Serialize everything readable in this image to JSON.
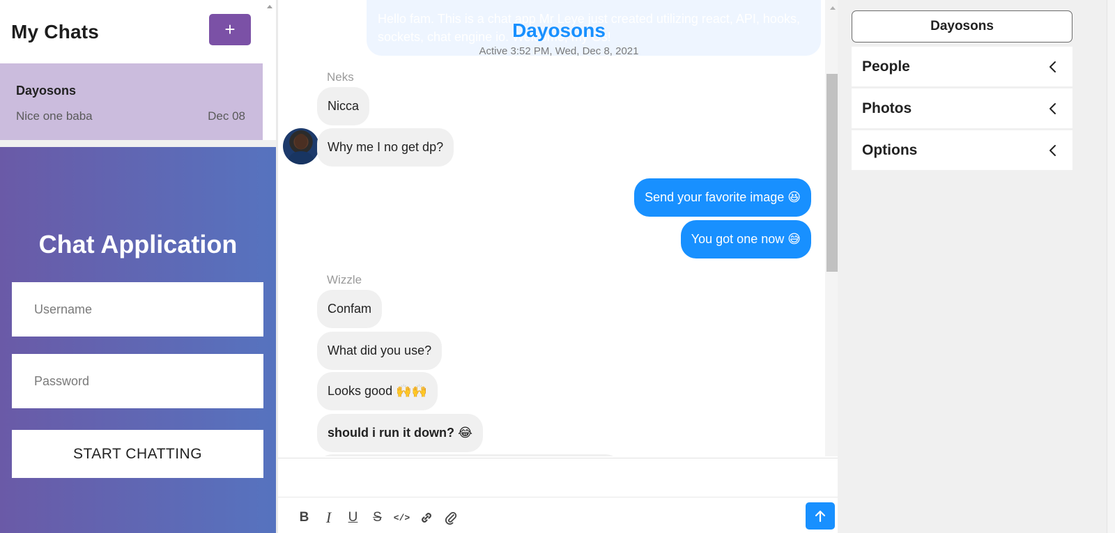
{
  "sidebar": {
    "title": "My Chats",
    "new_chat_label": "+",
    "chats": [
      {
        "name": "Dayosons",
        "preview": "Nice one baba",
        "date": "Dec 08"
      }
    ]
  },
  "login": {
    "title": "Chat Application",
    "username_placeholder": "Username",
    "password_placeholder": "Password",
    "submit_label": "START CHATTING"
  },
  "chat": {
    "title": "Dayosons",
    "subtitle": "Active 3:52 PM, Wed, Dec 8, 2021",
    "ghost_message": "Hello fam. This is a chat app Mr Leye just created utilizing react, API, hooks, sockets, chat engine io. Welcome, my Gs!",
    "groups": [
      {
        "sender": "Neks",
        "messages": [
          "Nicca",
          "Why me I no get dp?"
        ]
      },
      {
        "sender": "",
        "messages": [
          "Send your favorite image 😆",
          "You got one now 😅"
        ]
      },
      {
        "sender": "Wizzle",
        "messages": [
          "Confam",
          "What did you use?",
          "Looks good 🙌🙌",
          "should i run it down? 😂"
        ]
      }
    ]
  },
  "composer": {
    "tools": [
      "B",
      "I",
      "U",
      "S",
      "</>",
      "🔗",
      "📎"
    ]
  },
  "details": {
    "title": "Dayosons",
    "sections": [
      "People",
      "Photos",
      "Options"
    ]
  },
  "colors": {
    "accent": "#1890ff",
    "purple": "#7b51a6",
    "chat_card": "#cbbcdd",
    "login_gradient_start": "#6a5aa7",
    "login_gradient_end": "#5673bf"
  }
}
